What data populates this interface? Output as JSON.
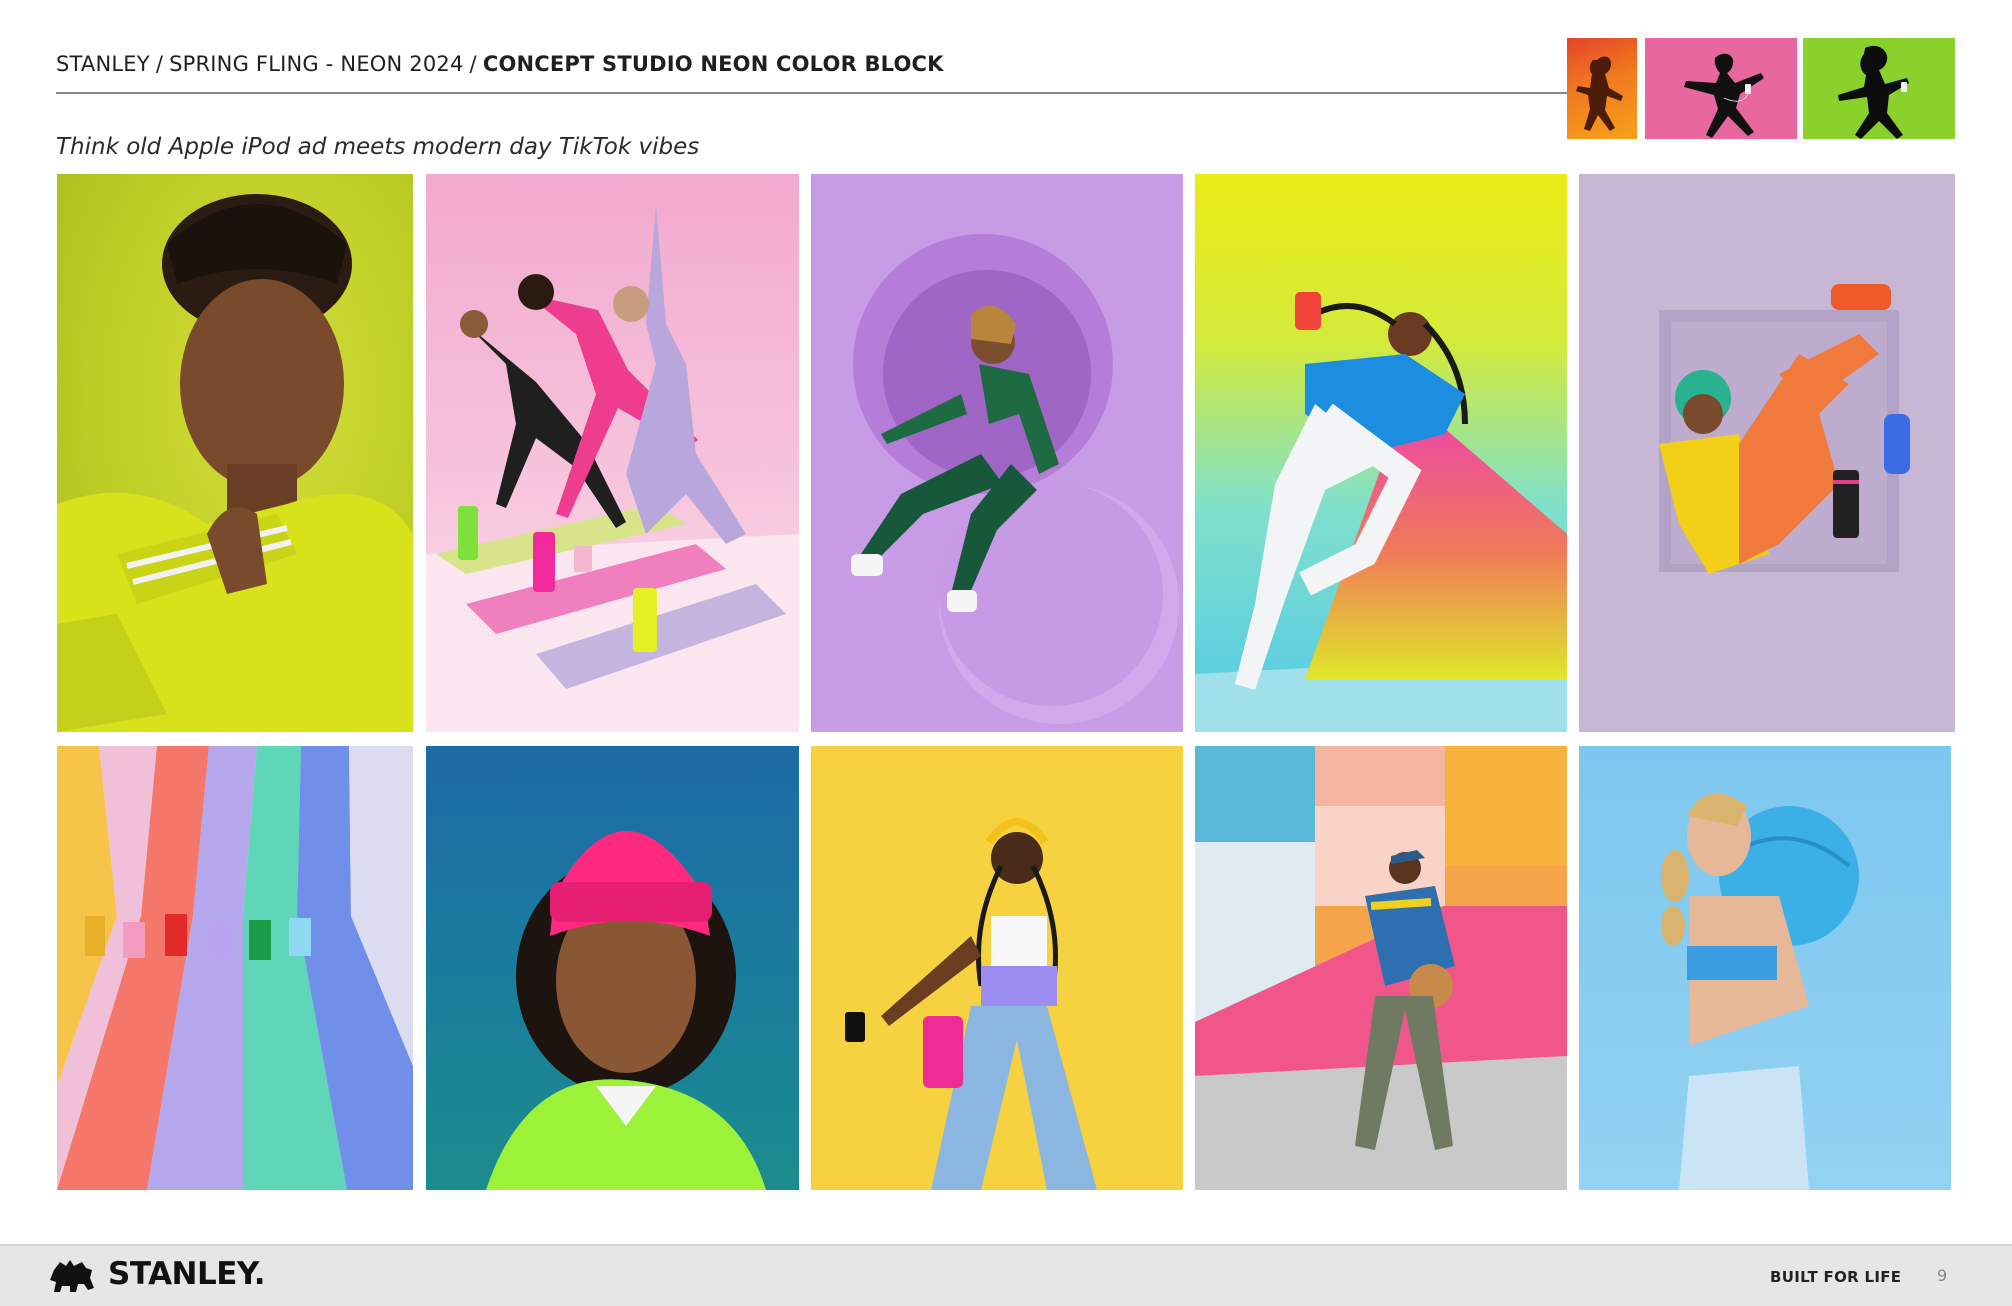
{
  "header": {
    "breadcrumb": [
      "STANLEY",
      "SPRING FLING - NEON 2024"
    ],
    "separator": "/",
    "current": "CONCEPT STUDIO NEON COLOR BLOCK"
  },
  "subtitle": "Think old Apple iPod ad meets modern day TikTok vibes",
  "reference_images": [
    {
      "name": "ipod-ad-orange",
      "background": "#e2452a"
    },
    {
      "name": "ipod-ad-pink",
      "background": "#e8679f"
    },
    {
      "name": "ipod-ad-green",
      "background": "#8bd12c"
    }
  ],
  "photos": [
    {
      "name": "man-yellow-tracksuit",
      "background": "#bccc24"
    },
    {
      "name": "yoga-group-pink-studio",
      "background": "#f6c4dc"
    },
    {
      "name": "woman-green-tracksuit-purple-set",
      "background": "#c89be6"
    },
    {
      "name": "woman-blue-fur-triangle",
      "background": "#7fe0cc"
    },
    {
      "name": "person-in-wall-niche",
      "background": "#c7b7d5"
    },
    {
      "name": "group-rainbow-stripes",
      "background": "#ececf4"
    },
    {
      "name": "woman-pink-beanie",
      "background": "#1a7e9c"
    },
    {
      "name": "woman-headphones-tumbler-yellow",
      "background": "#f7d240"
    },
    {
      "name": "man-basketball-color-blocks",
      "background": "#f5a44c"
    },
    {
      "name": "woman-blue-medicine-ball",
      "background": "#7cc7ef"
    }
  ],
  "footer": {
    "brand": "STANLEY.",
    "tagline": "BUILT FOR LIFE",
    "page_number": "9"
  }
}
